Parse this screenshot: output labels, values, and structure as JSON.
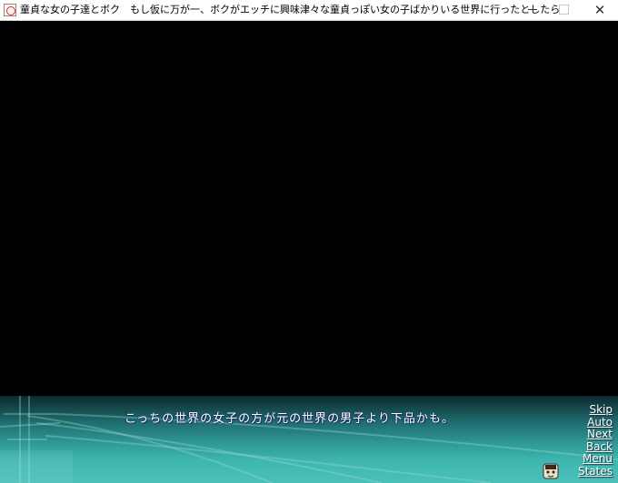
{
  "window": {
    "title": "童貞な女の子達とボク　もし仮に万が一、ボクがエッチに興味津々な童貞っぽい女の子ばかりいる世界に行ったとしたら",
    "icon": "app-icon",
    "controls": {
      "minimize": "minimize-icon",
      "maximize": "maximize-icon",
      "close": "✕"
    }
  },
  "game": {
    "dialogue": "こっちの世界の女子の方が元の世界の男子より下品かも。",
    "menu": {
      "skip": "Skip",
      "auto": "Auto",
      "next": "Next",
      "back": "Back",
      "menu": "Menu",
      "states": "States"
    }
  },
  "colors": {
    "textbox_top": "#0c2a2e",
    "textbox_bottom": "#49c0b8",
    "background": "#000000"
  }
}
